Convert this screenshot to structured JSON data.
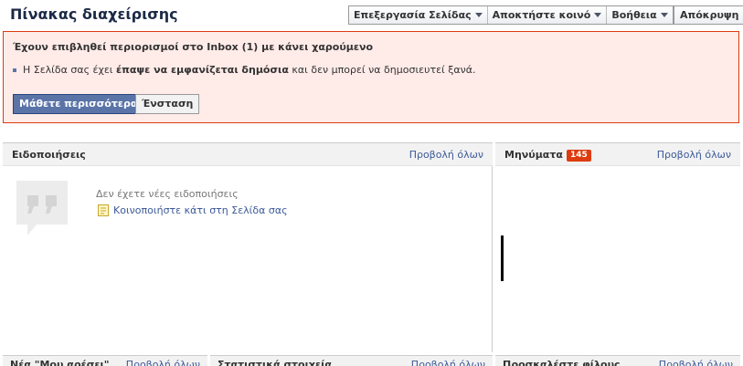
{
  "header": {
    "title": "Πίνακας διαχείρισης",
    "edit_page_label": "Επεξεργασία Σελίδας",
    "get_audience_label": "Αποκτήστε κοινό",
    "help_label": "Βοήθεια",
    "logout_label": "Απόκρυψη"
  },
  "alert": {
    "title": "Έχουν επιβληθεί περιορισμοί στο Inbox (1) με κάνει χαρούμενο",
    "bullet_prefix": "Η Σελίδα σας έχει ",
    "bullet_bold": "έπαψε να εμφανίζεται δημόσια",
    "bullet_suffix": " και δεν μπορεί να δημοσιευτεί ξανά.",
    "learn_more_label": "Μάθετε περισσότερα",
    "appeal_label": "Ένσταση"
  },
  "notifications": {
    "title": "Ειδοποιήσεις",
    "view_all": "Προβολή όλων",
    "empty_text": "Δεν έχετε νέες ειδοποιήσεις",
    "share_link": "Κοινοποιήστε κάτι στη Σελίδα σας"
  },
  "messages": {
    "title": "Μηνύματα",
    "count": "145",
    "view_all": "Προβολή όλων"
  },
  "bottom": {
    "likes_title": "Νέα \"Μου αρέσει\"",
    "likes_view_all": "Προβολή όλων",
    "stats_title": "Στατιστικά στοιχεία",
    "stats_view_all": "Προβολή όλων",
    "invite_title": "Προσκαλέστε φίλους",
    "invite_view_all": "Προβολή όλων"
  },
  "colors": {
    "link": "#3b5998",
    "alert_bg": "#ffebe8",
    "alert_border": "#dd3c10",
    "badge": "#dd3c10"
  }
}
